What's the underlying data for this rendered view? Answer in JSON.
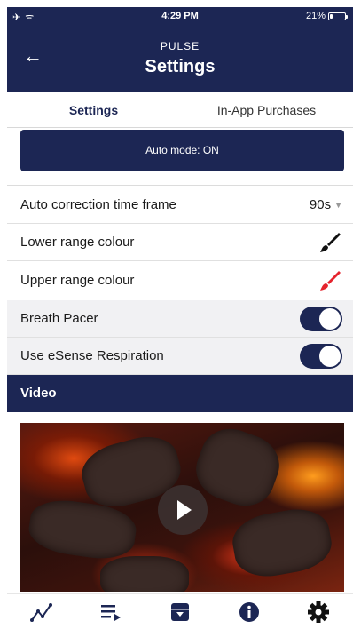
{
  "status_bar": {
    "left_icons": "✈ ᯤ",
    "time": "4:29 PM",
    "battery_percent": "21%",
    "battery_level": 0.21
  },
  "header": {
    "back_icon": "←",
    "subtitle": "PULSE",
    "title": "Settings"
  },
  "tabs": [
    {
      "label": "Settings",
      "active": true
    },
    {
      "label": "In-App Purchases",
      "active": false
    }
  ],
  "auto_mode_label": "Auto mode: ON",
  "settings": {
    "correction": {
      "label": "Auto correction time frame",
      "value": "90s"
    },
    "lower_colour": {
      "label": "Lower range colour",
      "color": "#111111"
    },
    "upper_colour": {
      "label": "Upper range colour",
      "color": "#e5232d"
    },
    "breath_pacer": {
      "label": "Breath Pacer",
      "on": true
    },
    "esense": {
      "label": "Use eSense Respiration",
      "on": true
    }
  },
  "video_section": {
    "title": "Video"
  },
  "tabbar": [
    "chart-line-icon",
    "playlist-icon",
    "archive-icon",
    "info-icon",
    "gear-icon"
  ],
  "colors": {
    "primary": "#1c2654"
  }
}
